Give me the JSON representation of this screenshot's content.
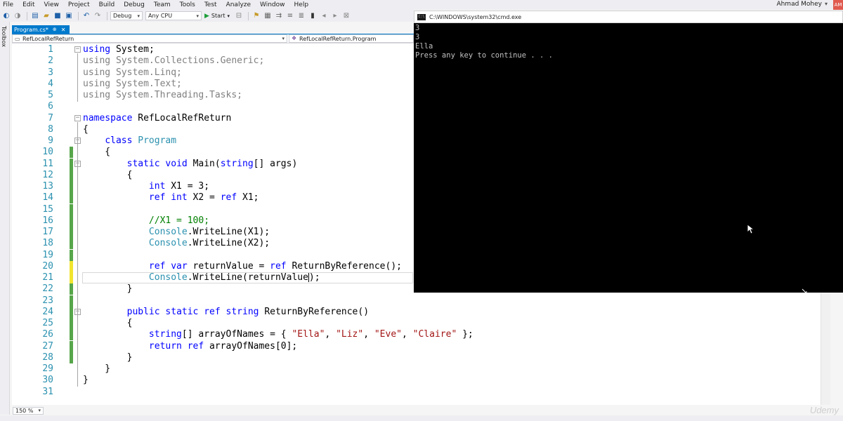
{
  "menu": {
    "items": [
      "File",
      "Edit",
      "View",
      "Project",
      "Build",
      "Debug",
      "Team",
      "Tools",
      "Test",
      "Analyze",
      "Window",
      "Help"
    ],
    "user": "Ahmad Mohey",
    "user_initials": "AM"
  },
  "toolbar": {
    "config": "Debug",
    "platform": "Any CPU",
    "start_label": "Start"
  },
  "toolbox": {
    "label": "Toolbox"
  },
  "tab": {
    "title": "Program.cs*",
    "pin": "⊕",
    "close": "✕"
  },
  "nav": {
    "project": "RefLocalRefReturn",
    "class": "RefLocalRefReturn.Program"
  },
  "code": {
    "lines": [
      {
        "n": "1",
        "t": "using System;"
      },
      {
        "n": "2",
        "t": "using System.Collections.Generic;"
      },
      {
        "n": "3",
        "t": "using System.Linq;"
      },
      {
        "n": "4",
        "t": "using System.Text;"
      },
      {
        "n": "5",
        "t": "using System.Threading.Tasks;"
      },
      {
        "n": "6",
        "t": ""
      },
      {
        "n": "7",
        "t": "namespace RefLocalRefReturn"
      },
      {
        "n": "8",
        "t": "{"
      },
      {
        "n": "9",
        "t": "    class Program"
      },
      {
        "n": "10",
        "t": "    {"
      },
      {
        "n": "11",
        "t": "        static void Main(string[] args)"
      },
      {
        "n": "12",
        "t": "        {"
      },
      {
        "n": "13",
        "t": "            int X1 = 3;"
      },
      {
        "n": "14",
        "t": "            ref int X2 = ref X1;"
      },
      {
        "n": "15",
        "t": ""
      },
      {
        "n": "16",
        "t": "            //X1 = 100;"
      },
      {
        "n": "17",
        "t": "            Console.WriteLine(X1);"
      },
      {
        "n": "18",
        "t": "            Console.WriteLine(X2);"
      },
      {
        "n": "19",
        "t": ""
      },
      {
        "n": "20",
        "t": "            ref var returnValue = ref ReturnByReference();"
      },
      {
        "n": "21",
        "t": "            Console.WriteLine(returnValue);"
      },
      {
        "n": "22",
        "t": "        }"
      },
      {
        "n": "23",
        "t": ""
      },
      {
        "n": "24",
        "t": "        public static ref string ReturnByReference()"
      },
      {
        "n": "25",
        "t": "        {"
      },
      {
        "n": "26",
        "t": "            string[] arrayOfNames = { \"Ella\", \"Liz\", \"Eve\", \"Claire\" };"
      },
      {
        "n": "27",
        "t": "            return ref arrayOfNames[0];"
      },
      {
        "n": "28",
        "t": "        }"
      },
      {
        "n": "29",
        "t": "    }"
      },
      {
        "n": "30",
        "t": "}"
      },
      {
        "n": "31",
        "t": ""
      }
    ]
  },
  "zoom": "150 %",
  "console": {
    "title": "C:\\WINDOWS\\system32\\cmd.exe",
    "icon_text": "C:\\",
    "lines": [
      "3",
      "3",
      "Ella",
      "Press any key to continue . . ."
    ]
  },
  "watermark": "Udemy",
  "colors": {
    "accent": "#007acc",
    "keyword": "#0000ff",
    "type": "#2b91af",
    "string": "#a31515",
    "comment": "#008000",
    "console_bg": "#000000",
    "console_fg": "#c0c0c0",
    "change_saved": "#57a64a",
    "change_unsaved": "#f2e52f"
  }
}
